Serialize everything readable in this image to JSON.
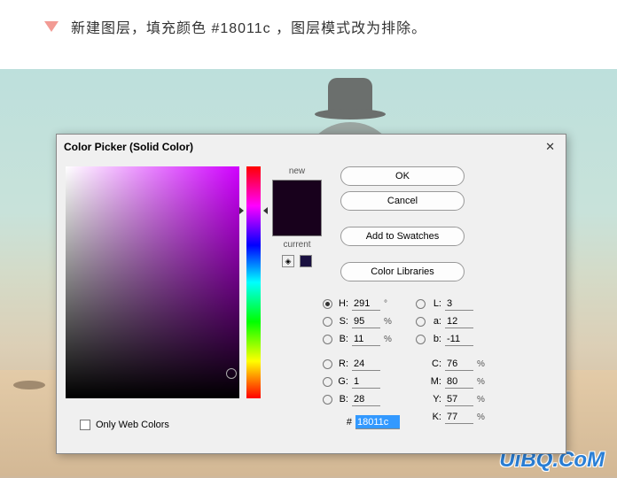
{
  "instruction": "新建图层，填充颜色 #18011c ，图层模式改为排除。",
  "dialog": {
    "title": "Color Picker (Solid Color)",
    "close": "✕",
    "preview_new_label": "new",
    "preview_current_label": "current",
    "new_color": "#18011c",
    "current_color": "#18011c",
    "mini_swatch_color": "#1a1040",
    "buttons": {
      "ok": "OK",
      "cancel": "Cancel",
      "add_swatches": "Add to Swatches",
      "color_libraries": "Color Libraries"
    },
    "only_web_colors": "Only Web Colors",
    "hsb": {
      "h_label": "H:",
      "h_val": "291",
      "h_unit": "°",
      "s_label": "S:",
      "s_val": "95",
      "s_unit": "%",
      "b_label": "B:",
      "b_val": "11",
      "b_unit": "%"
    },
    "lab": {
      "l_label": "L:",
      "l_val": "3",
      "a_label": "a:",
      "a_val": "12",
      "b_label": "b:",
      "b_val": "-11"
    },
    "rgb": {
      "r_label": "R:",
      "r_val": "24",
      "g_label": "G:",
      "g_val": "1",
      "b_label": "B:",
      "b_val": "28"
    },
    "cmyk": {
      "c_label": "C:",
      "c_val": "76",
      "unit": "%",
      "m_label": "M:",
      "m_val": "80",
      "y_label": "Y:",
      "y_val": "57",
      "k_label": "K:",
      "k_val": "77"
    },
    "hex_label": "#",
    "hex_val": "18011c"
  },
  "watermark": "UiBQ.CoM"
}
